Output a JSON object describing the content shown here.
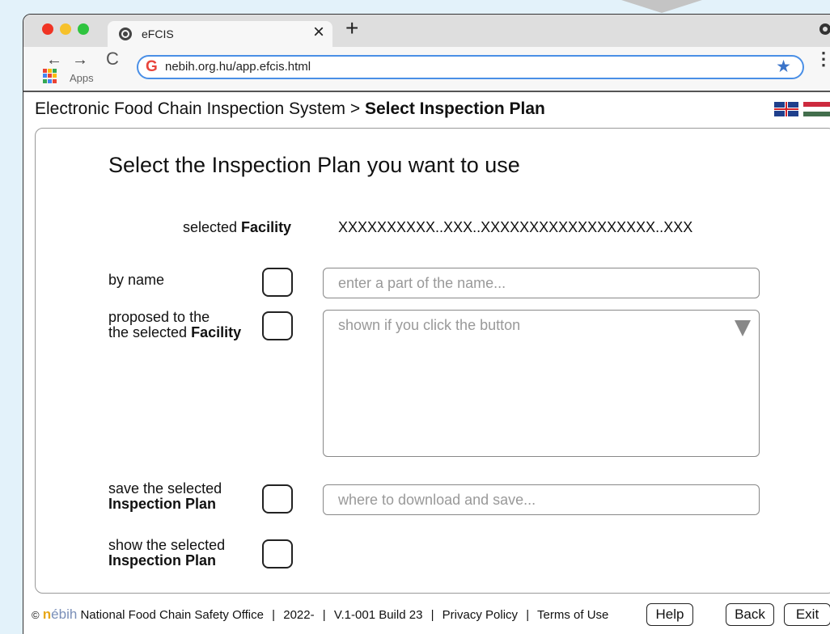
{
  "browser": {
    "tab_title": "eFCIS",
    "tab_close": "×",
    "new_tab": "+",
    "back_arrow": "←",
    "forward_arrow": "→",
    "reload": "C",
    "apps_label": "Apps",
    "url": "nebih.org.hu/app.efcis.html",
    "g_logo": "G",
    "star": "★",
    "menu": "⋮"
  },
  "app": {
    "breadcrumb_root": "Electronic Food Chain Inspection System",
    "breadcrumb_sep": " > ",
    "breadcrumb_current": "Select Inspection Plan"
  },
  "form": {
    "heading": "Select the Inspection Plan you want to use",
    "facility_label_prefix": "selected ",
    "facility_label_bold": "Facility",
    "facility_value": "XXXXXXXXXX..XXX..XXXXXXXXXXXXXXXXXX..XXX",
    "by_name_label": "by name",
    "name_placeholder": "enter a part of the name...",
    "proposed_line1": "proposed to the",
    "proposed_line2_prefix": "the selected ",
    "proposed_line2_bold": "Facility",
    "list_placeholder": "shown if you click the button",
    "save_line1": "save the selected",
    "save_line2": "Inspection Plan",
    "save_placeholder": "where to download and save...",
    "show_line1": "show the selected",
    "show_line2": "Inspection Plan"
  },
  "footer": {
    "copyright": "©",
    "logo_n": "n",
    "logo_rest": "ébih",
    "org": "National Food Chain Safety Office",
    "year": "2022-",
    "version": "V.1-001 Build 23",
    "privacy": "Privacy Policy",
    "terms": "Terms of Use",
    "separator": "|",
    "help": "Help",
    "back": "Back",
    "exit": "Exit"
  },
  "colors": {
    "background": "#e3f2fa",
    "accent": "#4a8fe6",
    "hu_red": "#cd2a3e",
    "hu_white": "#ffffff",
    "hu_green": "#436f4d",
    "apps_colors": [
      "#ea4335",
      "#fbbc05",
      "#34a853",
      "#4285f4",
      "#ea4335",
      "#fbbc05",
      "#34a853",
      "#4285f4",
      "#ea4335"
    ]
  }
}
